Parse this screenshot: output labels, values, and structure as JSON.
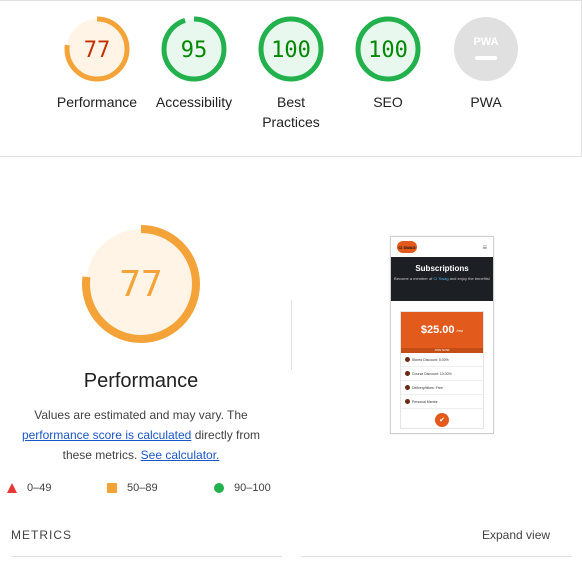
{
  "categories": [
    {
      "id": "performance",
      "score": "77",
      "label": "Performance",
      "status": "average"
    },
    {
      "id": "accessibility",
      "score": "95",
      "label": "Accessibility",
      "status": "pass"
    },
    {
      "id": "best-practices",
      "score": "100",
      "label_line1": "Best",
      "label_line2": "Practices",
      "status": "pass"
    },
    {
      "id": "seo",
      "score": "100",
      "label": "SEO",
      "status": "pass"
    },
    {
      "id": "pwa",
      "score": "PWA",
      "label": "PWA",
      "status": "na"
    }
  ],
  "main": {
    "score": "77",
    "title": "Performance",
    "desc_part1": "Values are estimated and may vary. The",
    "desc_link1": "performance score is calculated",
    "desc_part2": "directly from these metrics.",
    "desc_link2": "See calculator."
  },
  "legend": {
    "fail": "0–49",
    "average": "50–89",
    "pass": "90–100"
  },
  "metrics": {
    "title": "METRICS",
    "expand_label": "Expand view"
  },
  "screenshot": {
    "logo_text": "CI SWAG",
    "menu_icon": "≡",
    "hero_title": "Subscriptions",
    "hero_sub_a": "Become a member of",
    "hero_sub_link": "CI Swag",
    "hero_sub_b": "and enjoy the benefits!",
    "price": "$25.00",
    "price_unit": "/mo",
    "bar_text": "JOIN NOW",
    "rows": [
      "Stored Discount: 5.00%",
      "Course Discount: 10.00%",
      "Delivery/bikes: Free",
      "Personal Mentor"
    ],
    "check_icon": "✔"
  },
  "colors": {
    "average": "#f4a338",
    "average_text": "#c33300",
    "average_bg": "#fff4e6",
    "pass": "#22b14c",
    "pass_text": "#008800",
    "pass_bg": "#e9f8ee",
    "na": "#e0e0e0",
    "fail": "#e53935"
  }
}
